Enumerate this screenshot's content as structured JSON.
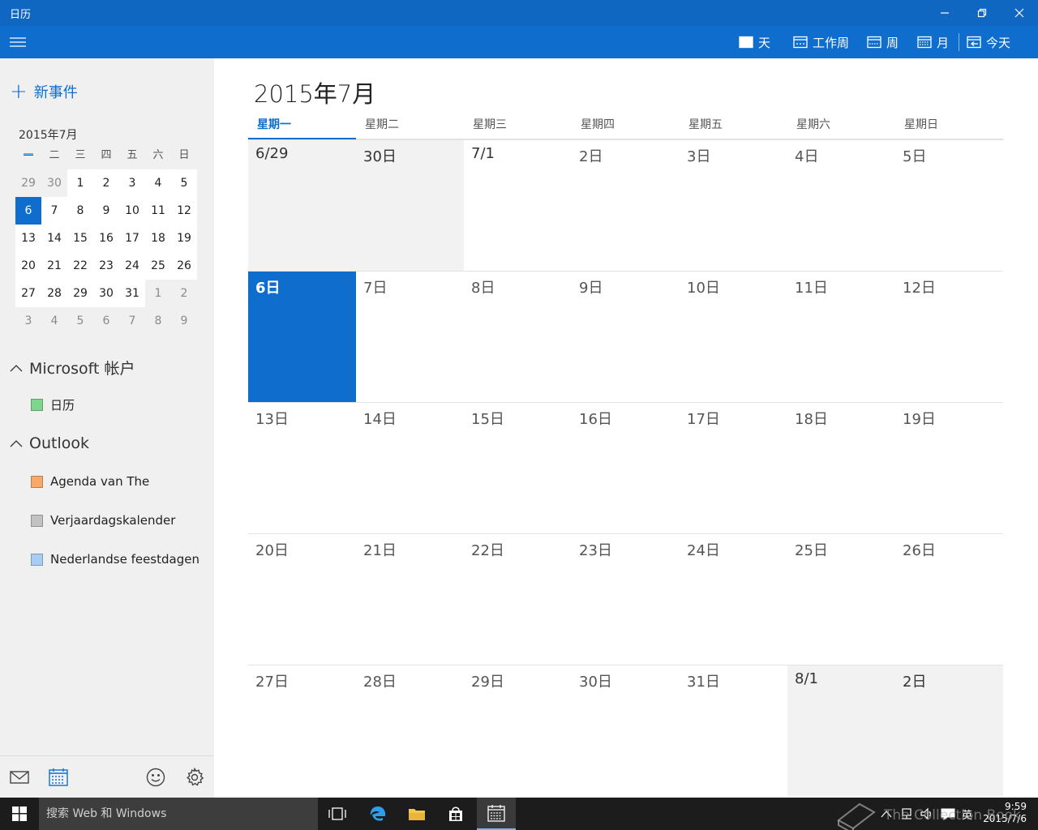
{
  "window": {
    "title": "日历"
  },
  "toolbar": {
    "day": "天",
    "workweek": "工作周",
    "week": "周",
    "month": "月",
    "today": "今天"
  },
  "sidebar": {
    "new_event": "新事件",
    "mini_title": "2015年7月",
    "weekday_abbr": [
      "一",
      "二",
      "三",
      "四",
      "五",
      "六",
      "日"
    ],
    "mini_days": [
      "29",
      "30",
      "1",
      "2",
      "3",
      "4",
      "5",
      "6",
      "7",
      "8",
      "9",
      "10",
      "11",
      "12",
      "13",
      "14",
      "15",
      "16",
      "17",
      "18",
      "19",
      "20",
      "21",
      "22",
      "23",
      "24",
      "25",
      "26",
      "27",
      "28",
      "29",
      "30",
      "31",
      "1",
      "2",
      "3",
      "4",
      "5",
      "6",
      "7",
      "8",
      "9"
    ],
    "selected_day": "6",
    "groups": [
      {
        "label": "Microsoft 帐户",
        "calendars": [
          {
            "name": "日历",
            "color": "#7fd58c"
          }
        ]
      },
      {
        "label": "Outlook",
        "calendars": [
          {
            "name": "Agenda van The",
            "color": "#f7a96a"
          },
          {
            "name": "Verjaardagskalender",
            "color": "#c2c2c2"
          },
          {
            "name": "Nederlandse feestdagen",
            "color": "#a9cdf2"
          }
        ]
      }
    ]
  },
  "main": {
    "month_title": "2015年7月",
    "weekdays": [
      "星期一",
      "星期二",
      "星期三",
      "星期四",
      "星期五",
      "星期六",
      "星期日"
    ],
    "days": [
      "6/29",
      "30日",
      "7/1",
      "2日",
      "3日",
      "4日",
      "5日",
      "6日",
      "7日",
      "8日",
      "9日",
      "10日",
      "11日",
      "12日",
      "13日",
      "14日",
      "15日",
      "16日",
      "17日",
      "18日",
      "19日",
      "20日",
      "21日",
      "22日",
      "23日",
      "24日",
      "25日",
      "26日",
      "27日",
      "28日",
      "29日",
      "30日",
      "31日",
      "8/1",
      "2日"
    ],
    "today_label": "6日"
  },
  "taskbar": {
    "search_placeholder": "搜索 Web 和 Windows",
    "ime": "英",
    "time": "9:59",
    "date": "2015/7/6"
  },
  "watermark": "The Collection Book",
  "colors": {
    "accent": "#0f6ecd",
    "titlebar": "#1067c2"
  }
}
